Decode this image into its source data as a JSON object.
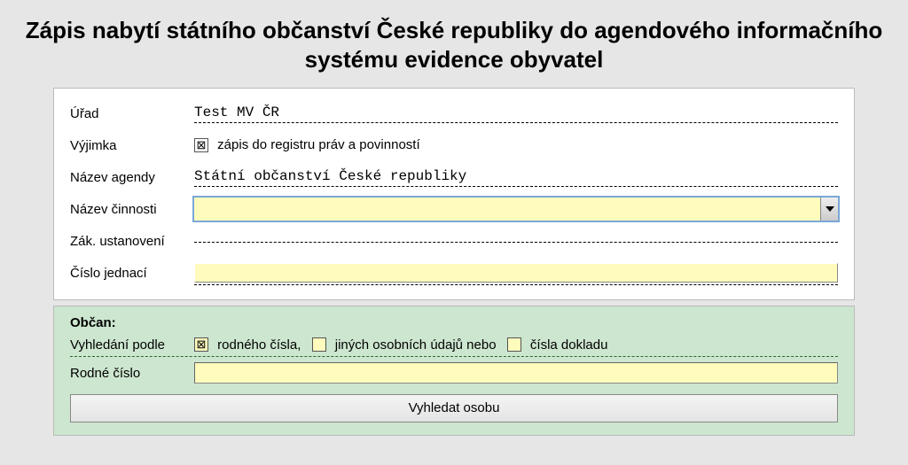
{
  "title": "Zápis nabytí státního občanství České republiky do agendového informačního systému evidence obyvatel",
  "form": {
    "labels": {
      "urad": "Úřad",
      "vyjimka": "Výjimka",
      "agenda": "Název agendy",
      "cinnost": "Název činnosti",
      "zak": "Zák. ustanovení",
      "cj": "Číslo jednací"
    },
    "urad_value": "Test MV ČR",
    "vyjimka_checked": "⊠",
    "vyjimka_text": "zápis do registru práv a povinností",
    "agenda_value": "Státní občanství České republiky",
    "cinnost_value": "",
    "zak_value": "",
    "cj_value": ""
  },
  "citizen": {
    "heading": "Občan:",
    "search_label": "Vyhledání podle",
    "opt1_mark": "⊠",
    "opt1_text": "rodného čísla,",
    "opt2_mark": "",
    "opt2_text": "jiných osobních údajů nebo",
    "opt3_mark": "",
    "opt3_text": "čísla dokladu",
    "rn_label": "Rodné číslo",
    "rn_value": "",
    "button": "Vyhledat osobu"
  }
}
